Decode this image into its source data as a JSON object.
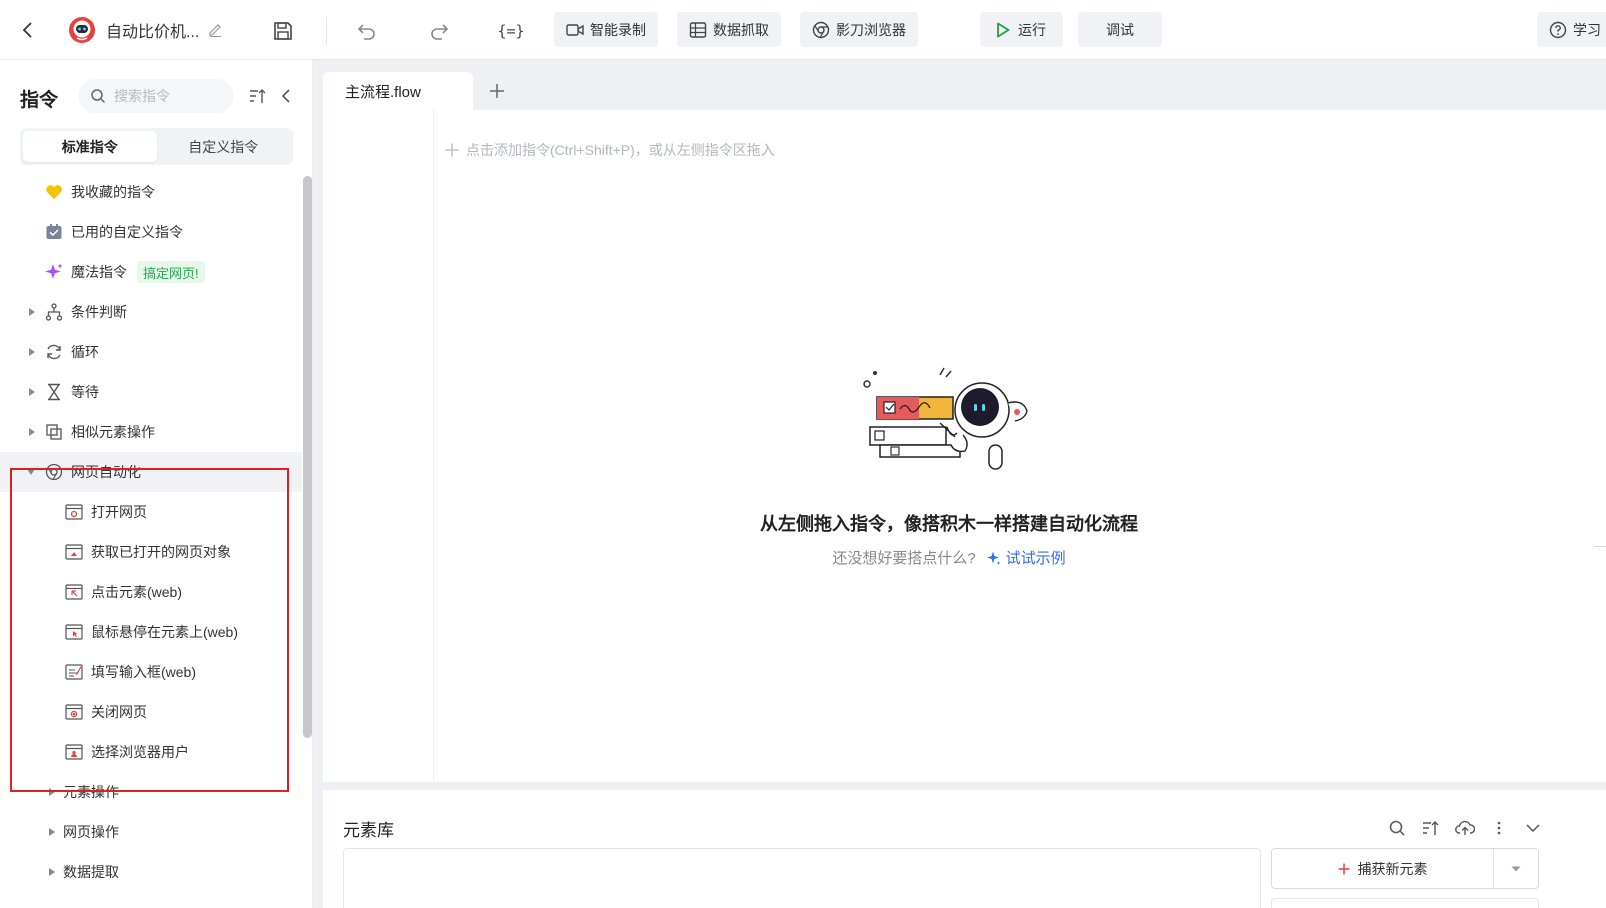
{
  "toolbar": {
    "app_title": "自动比价机...",
    "var_label": "{=}",
    "smart_record": "智能录制",
    "data_scrape": "数据抓取",
    "browser": "影刀浏览器",
    "run": "运行",
    "debug": "调试",
    "learn": "学习"
  },
  "sidebar": {
    "title": "指令",
    "search_placeholder": "搜索指令",
    "tabs": [
      "标准指令",
      "自定义指令"
    ],
    "items": [
      {
        "label": "我收藏的指令"
      },
      {
        "label": "已用的自定义指令"
      },
      {
        "label": "魔法指令",
        "tag": "搞定网页!"
      },
      {
        "label": "条件判断"
      },
      {
        "label": "循环"
      },
      {
        "label": "等待"
      },
      {
        "label": "相似元素操作"
      },
      {
        "label": "网页自动化"
      },
      {
        "label": "打开网页"
      },
      {
        "label": "获取已打开的网页对象"
      },
      {
        "label": "点击元素(web)"
      },
      {
        "label": "鼠标悬停在元素上(web)"
      },
      {
        "label": "填写输入框(web)"
      },
      {
        "label": "关闭网页"
      },
      {
        "label": "选择浏览器用户"
      },
      {
        "label": "元素操作"
      },
      {
        "label": "网页操作"
      },
      {
        "label": "数据提取"
      }
    ]
  },
  "editor": {
    "tab_label": "主流程.flow",
    "add_hint": "点击添加指令(Ctrl+Shift+P)，或从左侧指令区拖入",
    "empty_title": "从左侧拖入指令，像搭积木一样搭建自动化流程",
    "empty_question": "还没想好要搭点什么?",
    "try_example": "试试示例"
  },
  "element_library": {
    "title": "元素库",
    "capture_label": "捕获新元素"
  },
  "colors": {
    "accent_blue": "#2f6df6",
    "run_green": "#22a046",
    "highlight_red": "#e02020",
    "tag_green": "#2da44e",
    "favorite_yellow": "#f5c400",
    "magic_purple": "#b04cf0"
  }
}
